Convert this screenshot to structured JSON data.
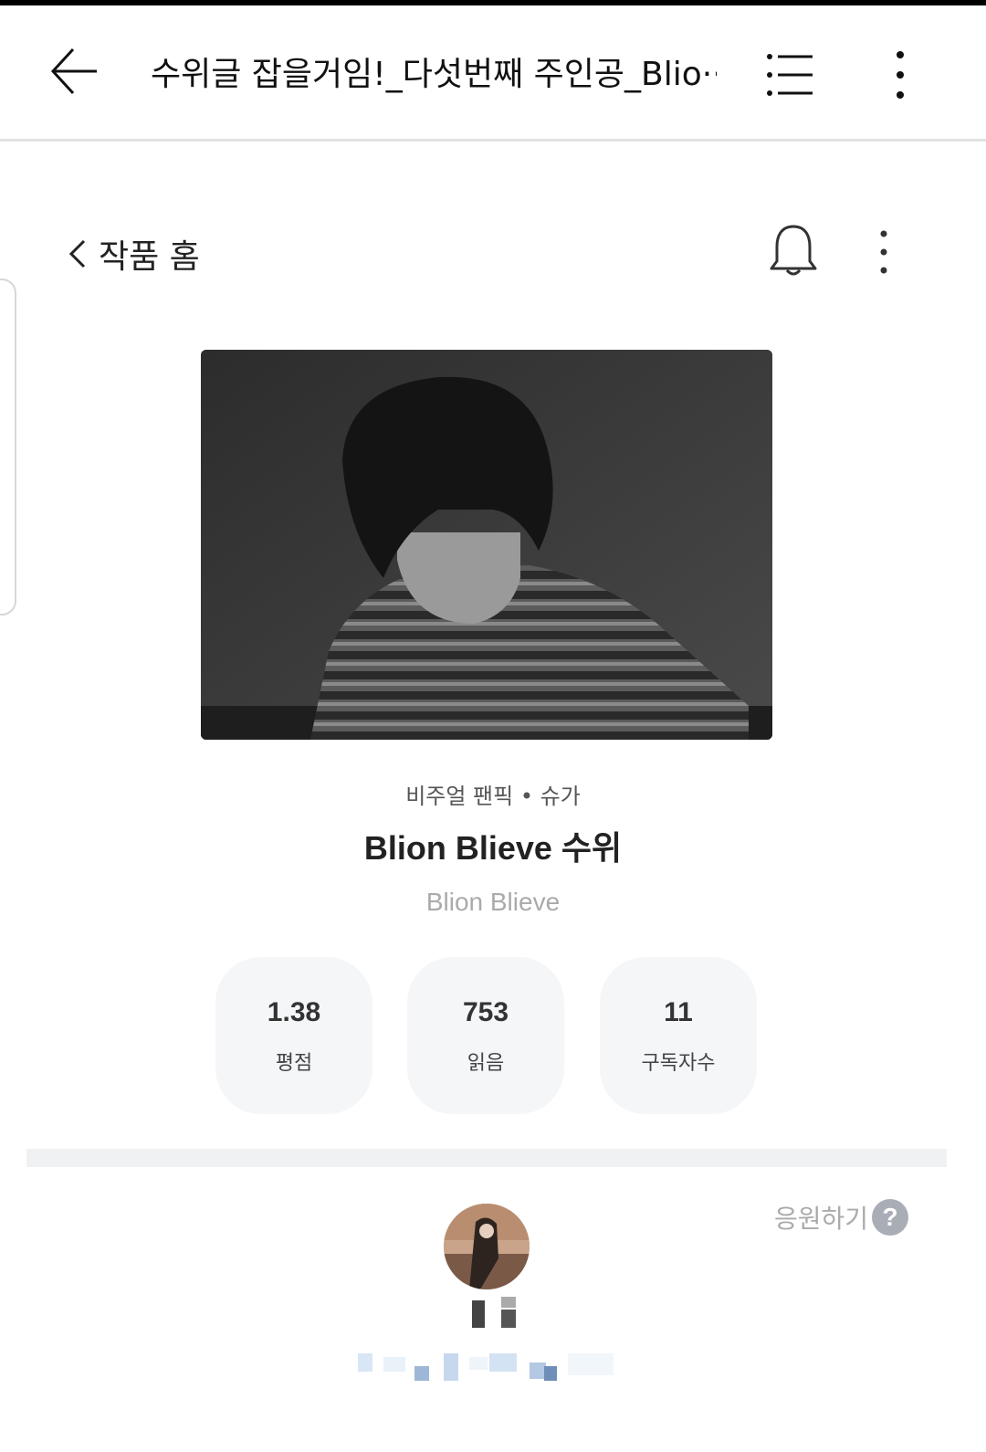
{
  "appbar": {
    "title": "수위글 잡을거임!_다섯번째 주인공_Blio···",
    "icons": [
      "back-arrow-icon",
      "list-icon",
      "more-vertical-icon"
    ]
  },
  "work_home": {
    "label": "작품 홈",
    "icons": [
      "chevron-left-icon",
      "bell-icon",
      "more-vertical-icon"
    ]
  },
  "work": {
    "genre": "비주얼 팬픽 • 슈가",
    "title": "Blion Blieve 수위",
    "author": "Blion Blieve"
  },
  "stats": [
    {
      "value": "1.38",
      "label": "평점"
    },
    {
      "value": "753",
      "label": "읽음"
    },
    {
      "value": "11",
      "label": "구독자수"
    }
  ],
  "support": {
    "label": "응원하기",
    "help_glyph": "?"
  }
}
